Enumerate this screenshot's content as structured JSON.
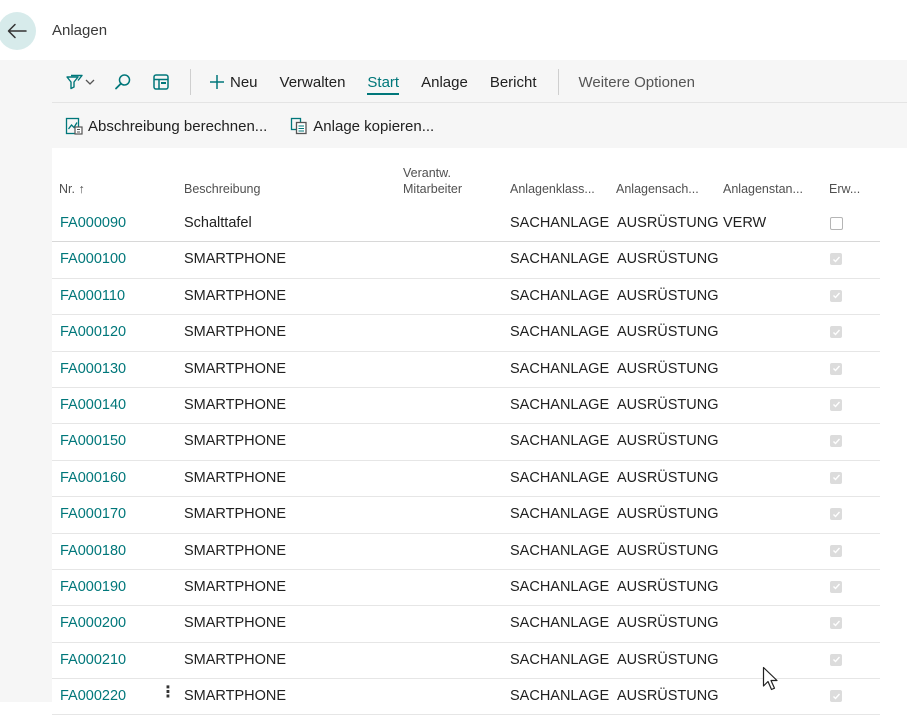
{
  "header": {
    "title": "Anlagen"
  },
  "actionbar": {
    "items": [
      "Neu",
      "Verwalten",
      "Start",
      "Anlage",
      "Bericht"
    ],
    "active": "Start",
    "more": "Weitere Optionen"
  },
  "actions": {
    "calc_depreciation": "Abschreibung berechnen...",
    "copy_asset": "Anlage kopieren..."
  },
  "table": {
    "columns": {
      "no": "Nr. ↑",
      "description": "Beschreibung",
      "responsible_line1": "Verantw.",
      "responsible_line2": "Mitarbeiter",
      "class": "Anlagenklass...",
      "subclass": "Anlagensach...",
      "location": "Anlagenstan...",
      "acquired": "Erw..."
    },
    "rows": [
      {
        "no": "FA000090",
        "description": "Schalttafel",
        "class": "SACHANLAGE",
        "subclass": "AUSRÜSTUNG",
        "location": "VERW",
        "acquired": false
      },
      {
        "no": "FA000100",
        "description": "SMARTPHONE",
        "class": "SACHANLAGE",
        "subclass": "AUSRÜSTUNG",
        "location": "",
        "acquired": true
      },
      {
        "no": "FA000110",
        "description": "SMARTPHONE",
        "class": "SACHANLAGE",
        "subclass": "AUSRÜSTUNG",
        "location": "",
        "acquired": true
      },
      {
        "no": "FA000120",
        "description": "SMARTPHONE",
        "class": "SACHANLAGE",
        "subclass": "AUSRÜSTUNG",
        "location": "",
        "acquired": true
      },
      {
        "no": "FA000130",
        "description": "SMARTPHONE",
        "class": "SACHANLAGE",
        "subclass": "AUSRÜSTUNG",
        "location": "",
        "acquired": true
      },
      {
        "no": "FA000140",
        "description": "SMARTPHONE",
        "class": "SACHANLAGE",
        "subclass": "AUSRÜSTUNG",
        "location": "",
        "acquired": true
      },
      {
        "no": "FA000150",
        "description": "SMARTPHONE",
        "class": "SACHANLAGE",
        "subclass": "AUSRÜSTUNG",
        "location": "",
        "acquired": true
      },
      {
        "no": "FA000160",
        "description": "SMARTPHONE",
        "class": "SACHANLAGE",
        "subclass": "AUSRÜSTUNG",
        "location": "",
        "acquired": true
      },
      {
        "no": "FA000170",
        "description": "SMARTPHONE",
        "class": "SACHANLAGE",
        "subclass": "AUSRÜSTUNG",
        "location": "",
        "acquired": true
      },
      {
        "no": "FA000180",
        "description": "SMARTPHONE",
        "class": "SACHANLAGE",
        "subclass": "AUSRÜSTUNG",
        "location": "",
        "acquired": true
      },
      {
        "no": "FA000190",
        "description": "SMARTPHONE",
        "class": "SACHANLAGE",
        "subclass": "AUSRÜSTUNG",
        "location": "",
        "acquired": true
      },
      {
        "no": "FA000200",
        "description": "SMARTPHONE",
        "class": "SACHANLAGE",
        "subclass": "AUSRÜSTUNG",
        "location": "",
        "acquired": true
      },
      {
        "no": "FA000210",
        "description": "SMARTPHONE",
        "class": "SACHANLAGE",
        "subclass": "AUSRÜSTUNG",
        "location": "",
        "acquired": true
      },
      {
        "no": "FA000220",
        "description": "SMARTPHONE",
        "class": "SACHANLAGE",
        "subclass": "AUSRÜSTUNG",
        "location": "",
        "acquired": true
      }
    ]
  },
  "icons": {
    "back": "arrow-left-icon",
    "filter": "filter-pane-icon",
    "search": "search-icon",
    "view": "view-layout-icon",
    "new": "plus-icon",
    "depreciation": "calculate-depreciation-icon",
    "copy": "copy-icon",
    "row_menu": "more-vertical-icon"
  },
  "colors": {
    "accent": "#00777a",
    "back_button_bg": "#d7ebeb"
  }
}
